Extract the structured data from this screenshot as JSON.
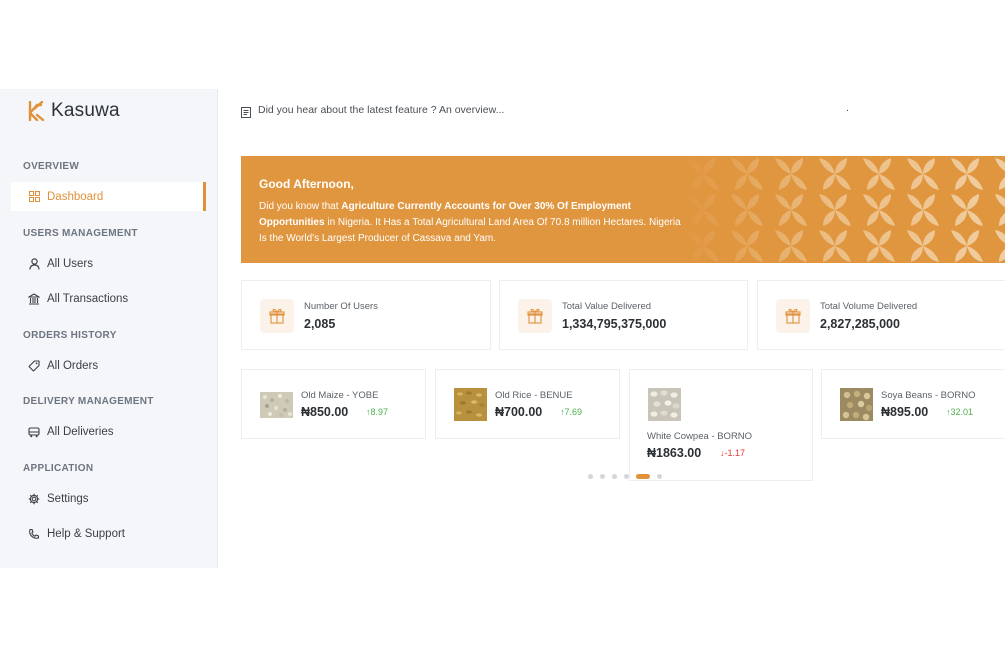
{
  "brand": {
    "name": "Kasuwa",
    "accent": "#e0913a"
  },
  "sidebar": {
    "sections": [
      {
        "title": "OVERVIEW"
      },
      {
        "title": "USERS MANAGEMENT"
      },
      {
        "title": "ORDERS HISTORY"
      },
      {
        "title": "DELIVERY MANAGEMENT"
      },
      {
        "title": "APPLICATION"
      }
    ],
    "items": [
      {
        "label": "Dashboard",
        "icon": "grid-icon",
        "active": true
      },
      {
        "label": "All Users",
        "icon": "user-icon"
      },
      {
        "label": "All Transactions",
        "icon": "bank-icon"
      },
      {
        "label": "All Orders",
        "icon": "tag-icon"
      },
      {
        "label": "All Deliveries",
        "icon": "vehicle-icon"
      },
      {
        "label": "Settings",
        "icon": "gear-icon"
      },
      {
        "label": "Help & Support",
        "icon": "phone-icon"
      }
    ]
  },
  "topbar": {
    "news": "Did you hear about the latest feature ? An overview...",
    "dot": "."
  },
  "banner": {
    "greeting": "Good Afternoon,",
    "fact_prefix": "Did you know that ",
    "fact_bold": "Agriculture Currently Accounts for Over 30% Of Employment Opportunities",
    "fact_suffix": " in Nigeria. It Has a Total Agricultural Land Area Of 70.8 million Hectares. Nigeria Is the World's Largest Producer of Cassava and Yam."
  },
  "stats": [
    {
      "label": "Number Of Users",
      "value": "2,085",
      "icon": "gift-box-icon"
    },
    {
      "label": "Total Value Delivered",
      "value": "1,334,795,375,000",
      "icon": "gift-box-icon"
    },
    {
      "label": "Total Volume Delivered",
      "value": "2,827,285,000",
      "icon": "gift-box-icon"
    }
  ],
  "products": [
    {
      "name": "Old Maize - YOBE",
      "price": "₦850.00",
      "change": "8.97",
      "direction": "up"
    },
    {
      "name": "Old Rice - BENUE",
      "price": "₦700.00",
      "change": "7.69",
      "direction": "up"
    },
    {
      "name": "White Cowpea - BORNO",
      "price": "₦1863.00",
      "change": "-1.17",
      "direction": "down"
    },
    {
      "name": "Soya Beans - BORNO",
      "price": "₦895.00",
      "change": "32.01",
      "direction": "up"
    }
  ],
  "carousel": {
    "total": 6,
    "active": 5
  }
}
